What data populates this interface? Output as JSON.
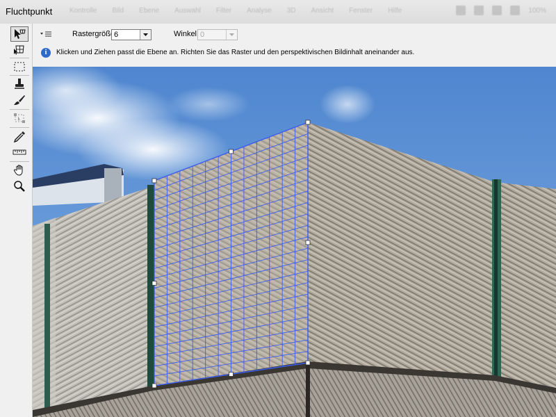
{
  "window": {
    "title": "Fluchtpunkt",
    "background_menu_items": [
      "Kontrolle",
      "Bild",
      "Ebene",
      "Auswahl",
      "Filter",
      "Analyse",
      "3D",
      "Ansicht",
      "Fenster",
      "Hilfe"
    ],
    "background_zoom": "100%"
  },
  "tools": [
    {
      "name": "edit-plane-tool",
      "icon": "pointer-plane-icon",
      "active": true
    },
    {
      "name": "create-plane-tool",
      "icon": "create-plane-icon",
      "active": false
    },
    {
      "name": "marquee-tool",
      "icon": "marquee-icon",
      "active": false
    },
    {
      "name": "stamp-tool",
      "icon": "stamp-icon",
      "active": false
    },
    {
      "name": "brush-tool",
      "icon": "brush-icon",
      "active": false
    },
    {
      "name": "transform-tool",
      "icon": "transform-icon",
      "active": false
    },
    {
      "name": "eyedropper-tool",
      "icon": "eyedropper-icon",
      "active": false
    },
    {
      "name": "measure-tool",
      "icon": "ruler-icon",
      "active": false
    },
    {
      "name": "hand-tool",
      "icon": "hand-icon",
      "active": false
    },
    {
      "name": "zoom-tool",
      "icon": "magnifier-icon",
      "active": false
    }
  ],
  "options": {
    "grid_size_label": "Rastergröße:",
    "grid_size_value": "6",
    "angle_label": "Winkel:",
    "angle_value": "0",
    "info_text": "Klicken und Ziehen passt die Ebene an. Richten Sie das Raster und den perspektivischen Bildinhalt aneinander aus."
  },
  "colors": {
    "grid": "#3a5cf0",
    "sky_top": "#4f86cf",
    "sky_bottom": "#9ec3ea",
    "facade": "#b3ab9f"
  }
}
